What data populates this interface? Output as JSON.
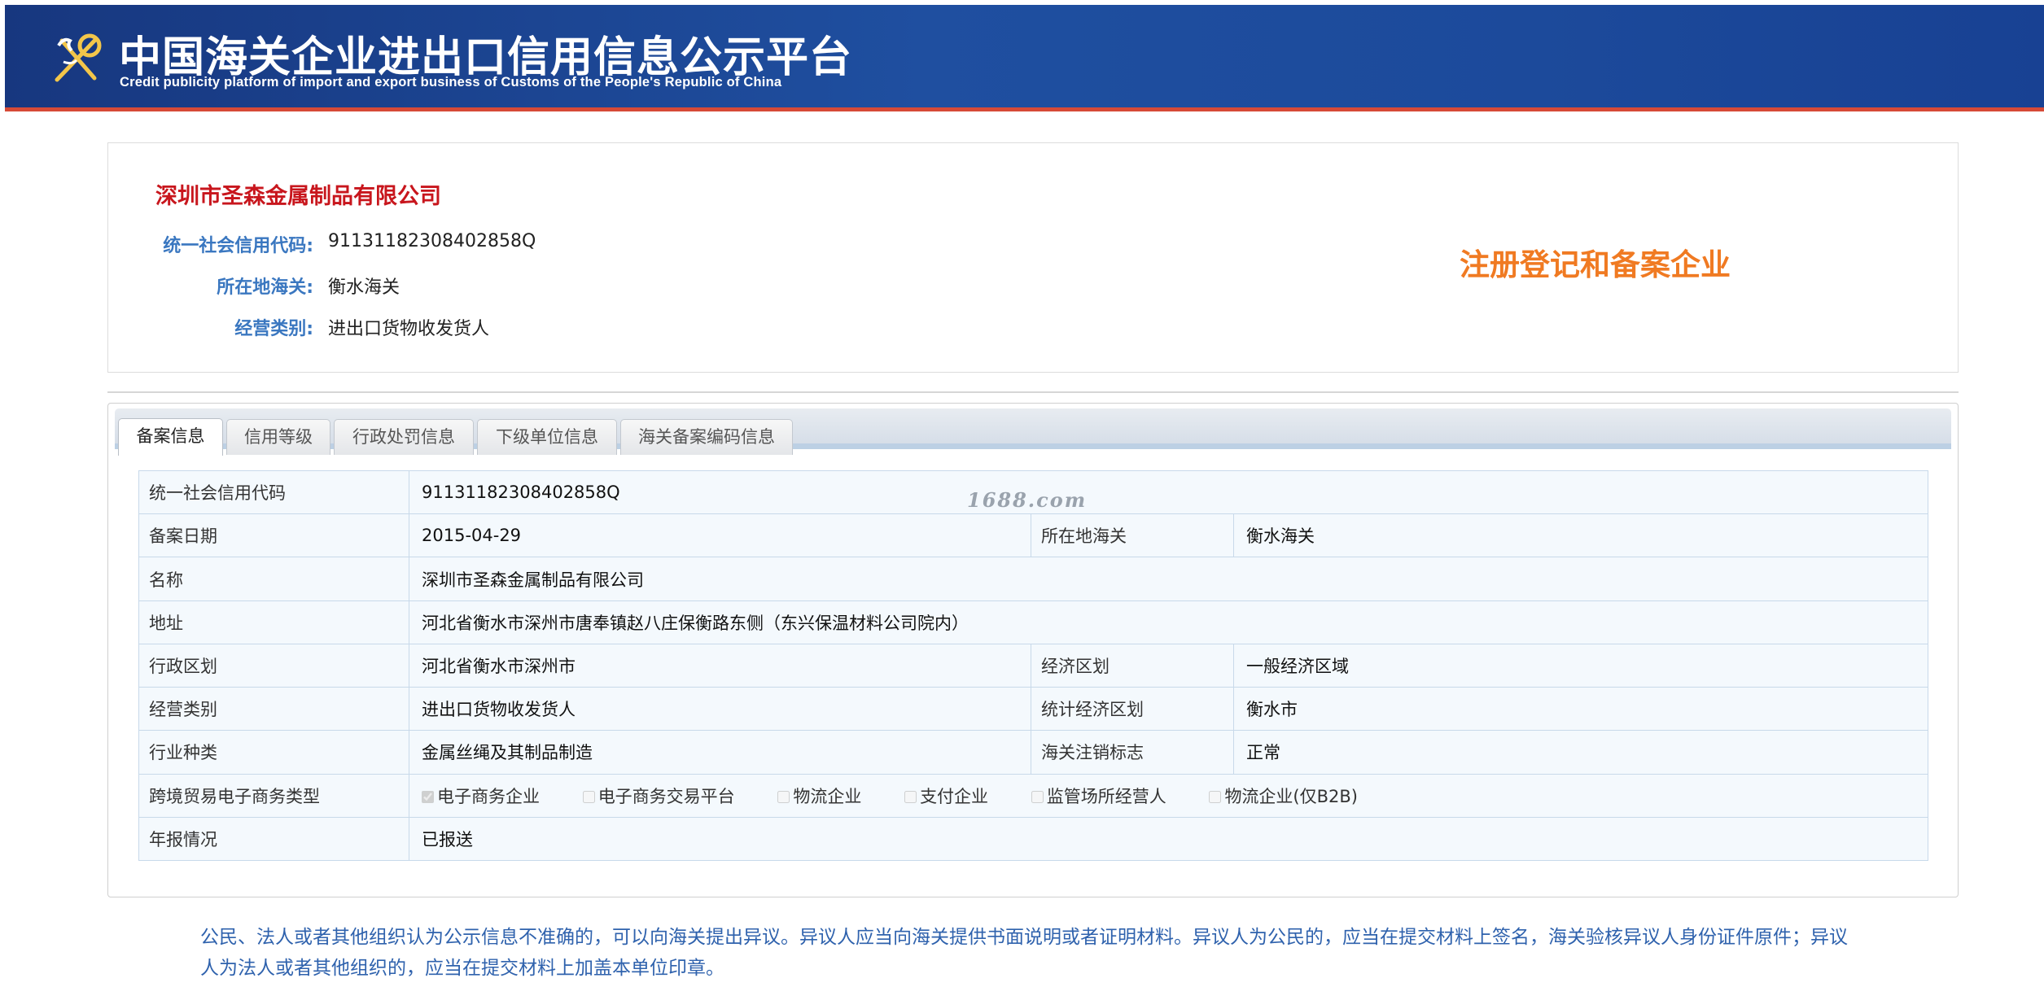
{
  "header": {
    "title": "中国海关企业进出口信用信息公示平台",
    "subtitle": "Credit publicity platform of import and export business of Customs of the People's Republic of China"
  },
  "company": {
    "name": "深圳市圣森金属制品有限公司",
    "fields": [
      {
        "label": "统一社会信用代码:",
        "value": "91131182308402858Q"
      },
      {
        "label": "所在地海关:",
        "value": "衡水海关"
      },
      {
        "label": "经营类别:",
        "value": "进出口货物收发货人"
      }
    ],
    "stamp": "注册登记和备案企业"
  },
  "tabs": [
    {
      "label": "备案信息",
      "active": true
    },
    {
      "label": "信用等级",
      "active": false
    },
    {
      "label": "行政处罚信息",
      "active": false
    },
    {
      "label": "下级单位信息",
      "active": false
    },
    {
      "label": "海关备案编码信息",
      "active": false
    }
  ],
  "table": {
    "credit_code_label": "统一社会信用代码",
    "credit_code_value": "91131182308402858Q",
    "record_date_label": "备案日期",
    "record_date_value": "2015-04-29",
    "customs_label": "所在地海关",
    "customs_value": "衡水海关",
    "name_label": "名称",
    "name_value": "深圳市圣森金属制品有限公司",
    "address_label": "地址",
    "address_value": "河北省衡水市深州市唐奉镇赵八庄保衡路东侧（东兴保温材料公司院内）",
    "admin_region_label": "行政区划",
    "admin_region_value": "河北省衡水市深州市",
    "economic_zone_label": "经济区划",
    "economic_zone_value": "一般经济区域",
    "business_type_label": "经营类别",
    "business_type_value": "进出口货物收发货人",
    "stat_zone_label": "统计经济区划",
    "stat_zone_value": "衡水市",
    "industry_label": "行业种类",
    "industry_value": "金属丝绳及其制品制造",
    "cancel_flag_label": "海关注销标志",
    "cancel_flag_value": "正常",
    "ecommerce_label": "跨境贸易电子商务类型",
    "ecommerce_options": [
      {
        "label": "电子商务企业",
        "checked": true
      },
      {
        "label": "电子商务交易平台",
        "checked": false
      },
      {
        "label": "物流企业",
        "checked": false
      },
      {
        "label": "支付企业",
        "checked": false
      },
      {
        "label": "监管场所经营人",
        "checked": false
      },
      {
        "label": "物流企业(仅B2B)",
        "checked": false
      }
    ],
    "annual_report_label": "年报情况",
    "annual_report_value": "已报送"
  },
  "watermark": "1688.com",
  "notice": "公民、法人或者其他组织认为公示信息不准确的，可以向海关提出异议。异议人应当向海关提供书面说明或者证明材料。异议人为公民的，应当在提交材料上签名，海关验核异议人身份证件原件；异议人为法人或者其他组织的，应当在提交材料上加盖本单位印章。",
  "colors": {
    "header_blue": "#1f4fa0",
    "header_red_line": "#d64a37",
    "company_name_red": "#c8161d",
    "label_blue": "#3a77c0",
    "stamp_orange": "#f07a22",
    "notice_blue": "#2f62ad"
  }
}
